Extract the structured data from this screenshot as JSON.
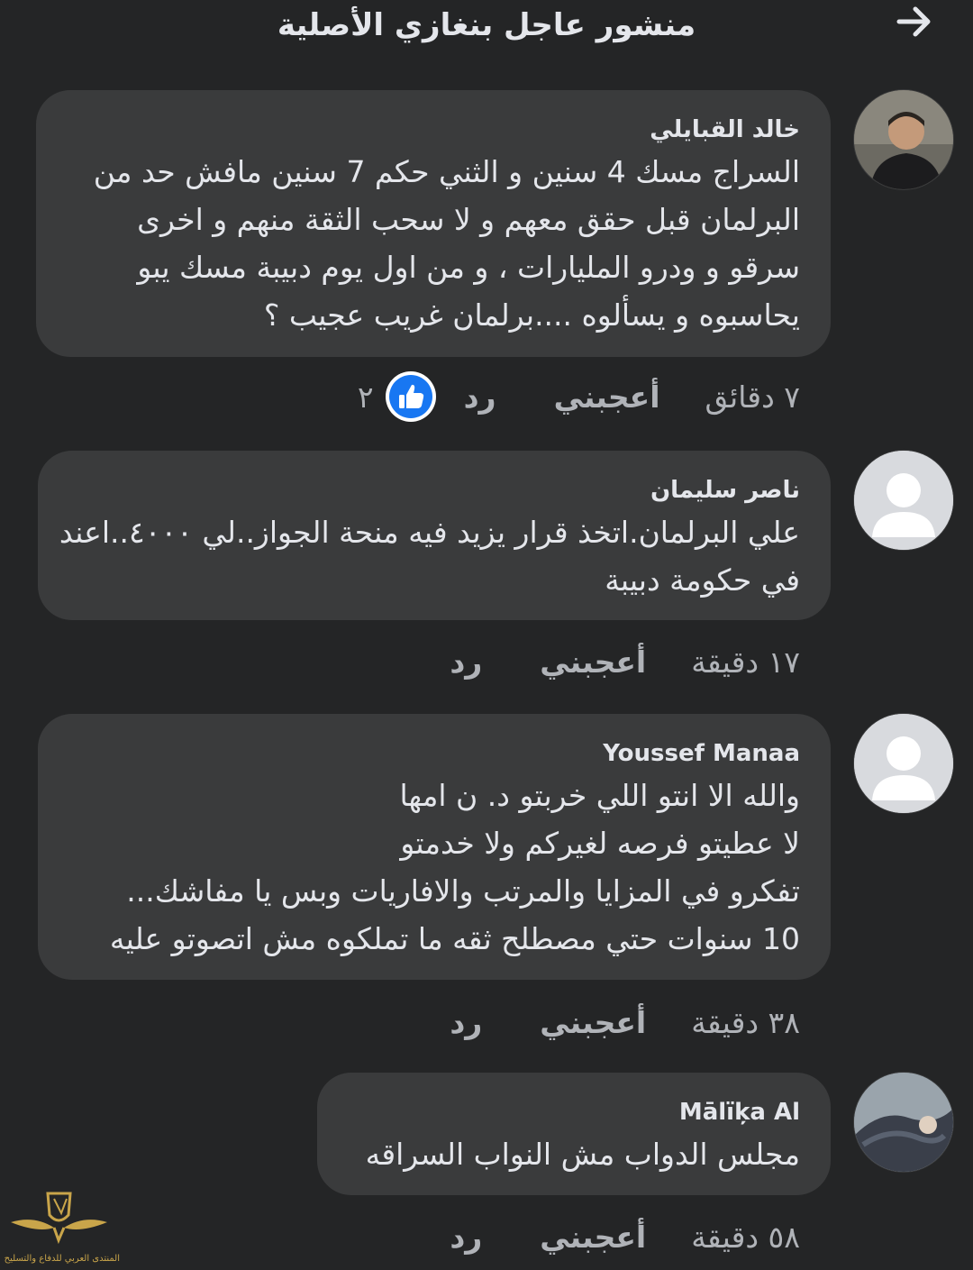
{
  "header": {
    "title": "منشور عاجل بنغازي الأصلية",
    "back_icon": "arrow-right-icon"
  },
  "comments": [
    {
      "author": "خالد القبايلي",
      "lines": [
        "السراج مسك 4 سنين و الثني حكم 7 سنين مافش حد من",
        "البرلمان قبل حقق معهم و لا سحب الثقة منهم و اخرى",
        "سرقو و ودرو المليارات ، و من اول يوم دبيبة مسك يبو",
        "يحاسبوه و يسألوه ....برلمان غريب عجيب ؟"
      ],
      "time": "٧ دقائق",
      "like_label": "أعجبني",
      "reply_label": "رد",
      "reaction_count": "٢",
      "avatar": "photo-avatar"
    },
    {
      "author": "ناصر سليمان",
      "lines": [
        "علي البرلمان.اتخذ قرار يزيد فيه منحة الجواز..لي ٤٠٠٠..اعند",
        "في حكومة دبيبة"
      ],
      "time": "١٧ دقيقة",
      "like_label": "أعجبني",
      "reply_label": "رد",
      "avatar": "default-avatar"
    },
    {
      "author": "Youssef Manaa",
      "lines": [
        "والله الا انتو اللي خربتو د.   ن امها",
        "لا عطيتو فرصه لغيركم ولا خدمتو",
        "تفكرو في المزايا والمرتب والافاريات وبس يا مفاشك...",
        "10 سنوات حتي مصطلح ثقه ما تملكوه مش اتصوتو عليه"
      ],
      "time": "٣٨ دقيقة",
      "like_label": "أعجبني",
      "reply_label": "رد",
      "avatar": "default-avatar"
    },
    {
      "author": "Mālïķa Al",
      "lines": [
        "مجلس الدواب مش النواب السراقه"
      ],
      "time": "٥٨ دقيقة",
      "like_label": "أعجبني",
      "reply_label": "رد",
      "avatar": "photo-avatar"
    }
  ],
  "watermark": {
    "text": "المنتدى العربي للدفاع والتسليح"
  },
  "colors": {
    "background": "#242526",
    "bubble": "#3a3b3c",
    "text": "#e4e6eb",
    "secondary": "#b0b3b8",
    "like_blue": "#1877f2"
  }
}
